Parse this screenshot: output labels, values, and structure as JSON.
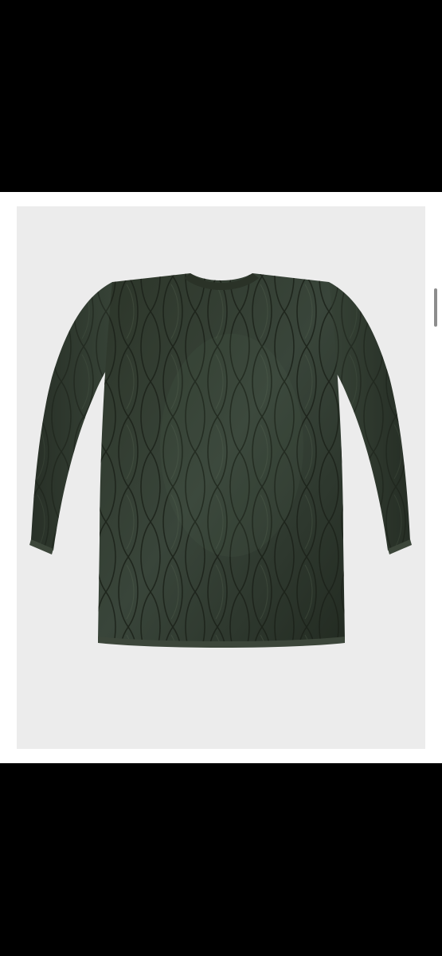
{
  "viewer": {
    "background_color": "#000000",
    "content_background_color": "#ffffff",
    "photo_background_color": "#ececec"
  },
  "product_image": {
    "subject_icon": "quilted-liner-jacket-icon",
    "jacket_color": "#2f3a2c"
  }
}
